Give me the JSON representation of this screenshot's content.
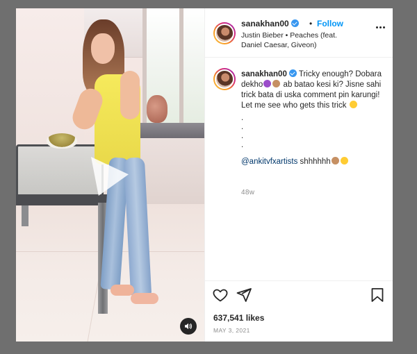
{
  "post": {
    "username": "sanakhan00",
    "follow_label": "Follow",
    "separator": "•",
    "audio": "Justin Bieber • Peaches (feat. Daniel Caesar, Giveon)",
    "caption": {
      "username": "sanakhan00",
      "text_part1": "Tricky enough? Dobara dekho",
      "text_part2": "ab batao kesi ki? Jisne sahi trick bata di uska comment pin karungi! Let me see who gets this trick",
      "dots": [
        ".",
        ".",
        ".",
        "."
      ],
      "mention": "@ankitvfxartists",
      "mention_after": "shhhhhh",
      "time": "48w"
    },
    "likes": "637,541 likes",
    "date": "MAY 3, 2021"
  },
  "icons": {
    "verified": "verified-badge-icon",
    "more": "more-options-icon",
    "audio": "speaker-icon",
    "like": "heart-icon",
    "share": "paper-plane-icon",
    "save": "bookmark-icon"
  },
  "colors": {
    "follow": "#0095f6",
    "verified": "#3897f0",
    "mention": "#00376b",
    "muted_text": "#8e8e8e"
  }
}
